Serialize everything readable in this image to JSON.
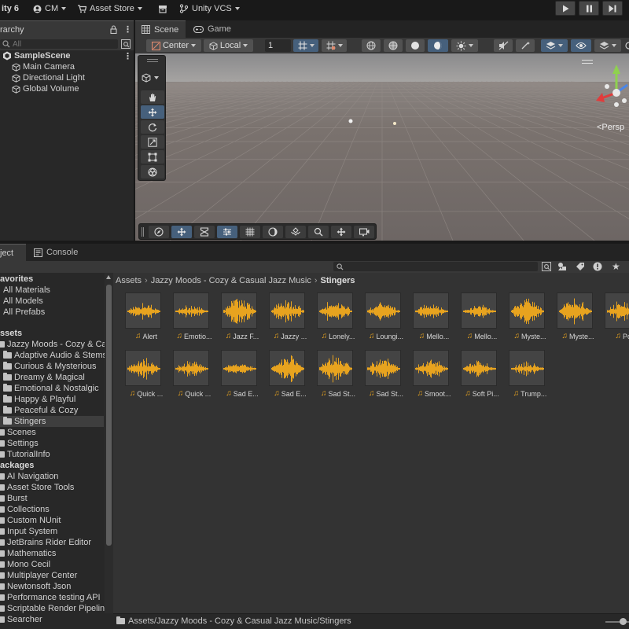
{
  "topbar": {
    "app_title": "ity 6",
    "account": "CM",
    "asset_store": "Asset Store",
    "vcs": "Unity VCS"
  },
  "hierarchy": {
    "tab_label": "rarchy",
    "search_placeholder": "All",
    "scene": "SampleScene",
    "items": [
      "Main Camera",
      "Directional Light",
      "Global Volume"
    ]
  },
  "scene_view": {
    "tabs": [
      "Scene",
      "Game"
    ],
    "pivot": "Center",
    "space": "Local",
    "snap_value": "1",
    "projection": "<Persp"
  },
  "project": {
    "tabs": [
      "ject",
      "Console"
    ],
    "favorites_header": "avorites",
    "favorites": [
      "All Materials",
      "All Models",
      "All Prefabs"
    ],
    "assets_header": "ssets",
    "assets_root": "Jazzy Moods - Cozy & Ca",
    "asset_folders": [
      "Adaptive Audio & Stems",
      "Curious & Mysterious",
      "Dreamy & Magical",
      "Emotional & Nostalgic",
      "Happy & Playful",
      "Peaceful & Cozy",
      "Stingers"
    ],
    "selected_folder": "Stingers",
    "root_folders": [
      "Scenes",
      "Settings",
      "TutorialInfo"
    ],
    "packages_header": "ackages",
    "packages": [
      "AI Navigation",
      "Asset Store Tools",
      "Burst",
      "Collections",
      "Custom NUnit",
      "Input System",
      "JetBrains Rider Editor",
      "Mathematics",
      "Mono Cecil",
      "Multiplayer Center",
      "Newtonsoft Json",
      "Performance testing API",
      "Scriptable Render Pipeline",
      "Searcher"
    ],
    "breadcrumb": [
      "Assets",
      "Jazzy Moods - Cozy & Casual Jazz Music",
      "Stingers"
    ],
    "assets": [
      "Alert",
      "Emotio...",
      "Jazz F...",
      "Jazzy ...",
      "Lonely...",
      "Loungi...",
      "Mello...",
      "Mello...",
      "Myste...",
      "Myste...",
      "Posi",
      "Quick ...",
      "Quick ...",
      "Sad E...",
      "Sad E...",
      "Sad St...",
      "Sad St...",
      "Smoot...",
      "Soft Pi...",
      "Trump..."
    ],
    "status_path": "Assets/Jazzy Moods - Cozy & Casual Jazz Music/Stingers"
  },
  "colors": {
    "waveform": "#e7a31f",
    "selection": "#46607c",
    "panel": "#282828"
  }
}
